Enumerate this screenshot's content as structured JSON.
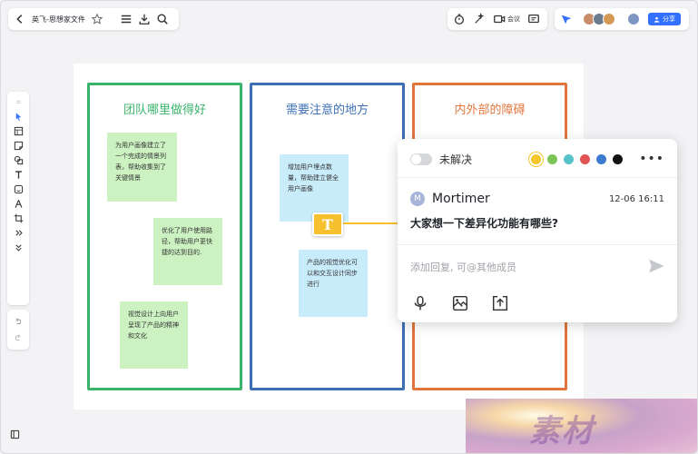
{
  "header": {
    "doc_title": "英飞-思想家文件",
    "meeting_label": "会议",
    "share_label": "分享"
  },
  "board": {
    "columns": [
      {
        "title": "团队哪里做得好",
        "color": "#3bb36b"
      },
      {
        "title": "需要注意的地方",
        "color": "#3d6fb5"
      },
      {
        "title": "内外部的障碍",
        "color": "#e0763e"
      }
    ],
    "stickies": [
      {
        "text": "为用户画像建立了一个完成的情景列表，帮助收集到了关键情景"
      },
      {
        "text": "优化了用户使用路径，帮助用户更快捷的达到目的."
      },
      {
        "text": "视觉设计上向用户呈现了产品的精神和文化"
      },
      {
        "text": "增加用户埋点数量，帮助建立健全用户画像"
      },
      {
        "text": "产品的视觉优化可以和交互设计同步进行"
      }
    ],
    "marker_letter": "T"
  },
  "comment": {
    "status_label": "未解决",
    "colors": [
      "#f6c62c",
      "#7cc35a",
      "#55c3c7",
      "#e25454",
      "#3d7bd1",
      "#111111"
    ],
    "author_initial": "M",
    "author": "Mortimer",
    "time": "12-06 16:11",
    "text": "大家想一下差异化功能有哪些?",
    "reply_placeholder": "添加回复, 可@其他成员"
  },
  "icons": [
    "back-icon",
    "star-icon",
    "menu-icon",
    "download-icon",
    "search-icon",
    "timer-icon",
    "magic-icon",
    "video-icon",
    "comment-icon",
    "presenter-icon",
    "share-icon",
    "cursor-icon",
    "frame-icon",
    "sticky-note-icon",
    "shape-icon",
    "text-icon",
    "emoji-icon",
    "pen-icon",
    "crop-icon",
    "more-icon",
    "expand-icon",
    "undo-icon",
    "redo-icon",
    "sidebar-icon",
    "mic-icon",
    "image-icon",
    "upload-icon",
    "send-icon"
  ]
}
